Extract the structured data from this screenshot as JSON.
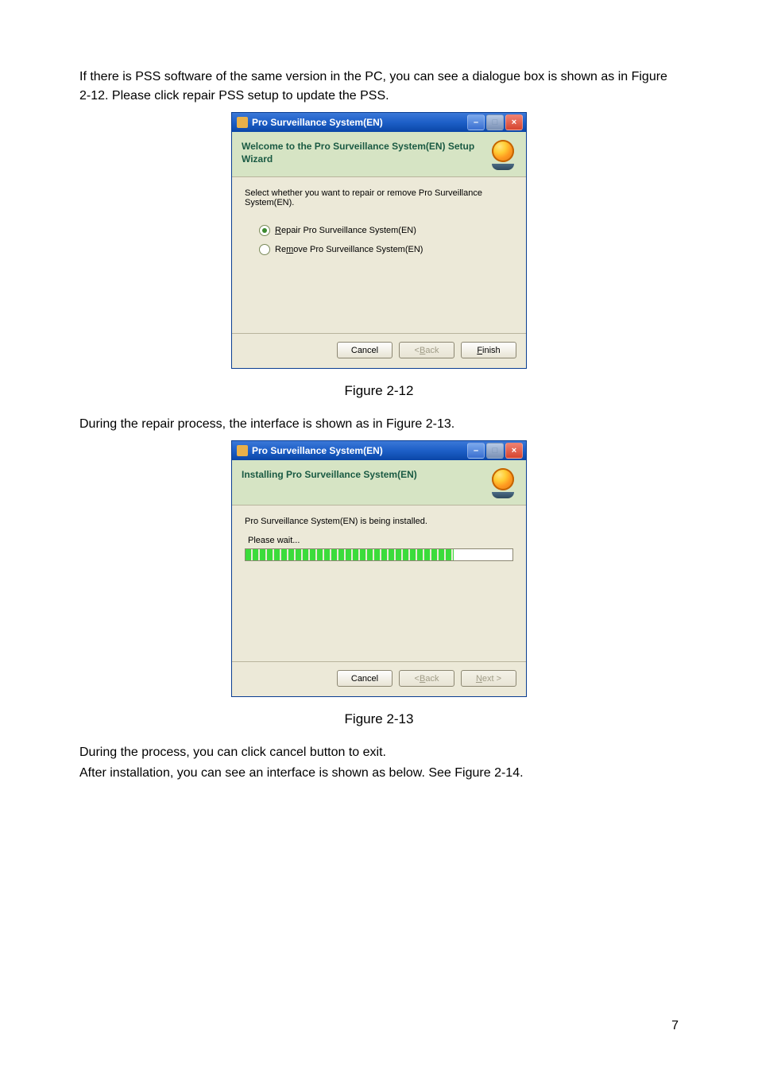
{
  "para1": "If there is PSS software of the same version in the PC, you can see a dialogue box is shown as in Figure 2-12. Please click repair PSS setup to update the PSS.",
  "caption1": "Figure 2-12",
  "para2": "During the repair process, the interface is shown as in Figure 2-13.",
  "caption2": "Figure 2-13",
  "para3a": "During the process, you can click cancel button to exit.",
  "para3b": "After installation, you can see an interface is shown as below. See Figure 2-14.",
  "page_number": "7",
  "dialog1": {
    "title": "Pro Surveillance System(EN)",
    "header": "Welcome to the Pro Surveillance System(EN) Setup Wizard",
    "instruction": "Select whether you want to repair or remove Pro Surveillance System(EN).",
    "repair_prefix": "R",
    "repair_rest": "epair Pro Surveillance System(EN)",
    "remove_prefix": "Re",
    "remove_u": "m",
    "remove_rest": "ove Pro Surveillance System(EN)",
    "cancel": "Cancel",
    "back_lt": "< ",
    "back_u": "B",
    "back_rest": "ack",
    "finish_u": "F",
    "finish_rest": "inish"
  },
  "dialog2": {
    "title": "Pro Surveillance System(EN)",
    "header": "Installing Pro Surveillance System(EN)",
    "instruction": "Pro Surveillance System(EN) is being installed.",
    "please_wait": "Please wait...",
    "cancel": "Cancel",
    "back_lt": "< ",
    "back_u": "B",
    "back_rest": "ack",
    "next_u": "N",
    "next_rest": "ext >"
  }
}
